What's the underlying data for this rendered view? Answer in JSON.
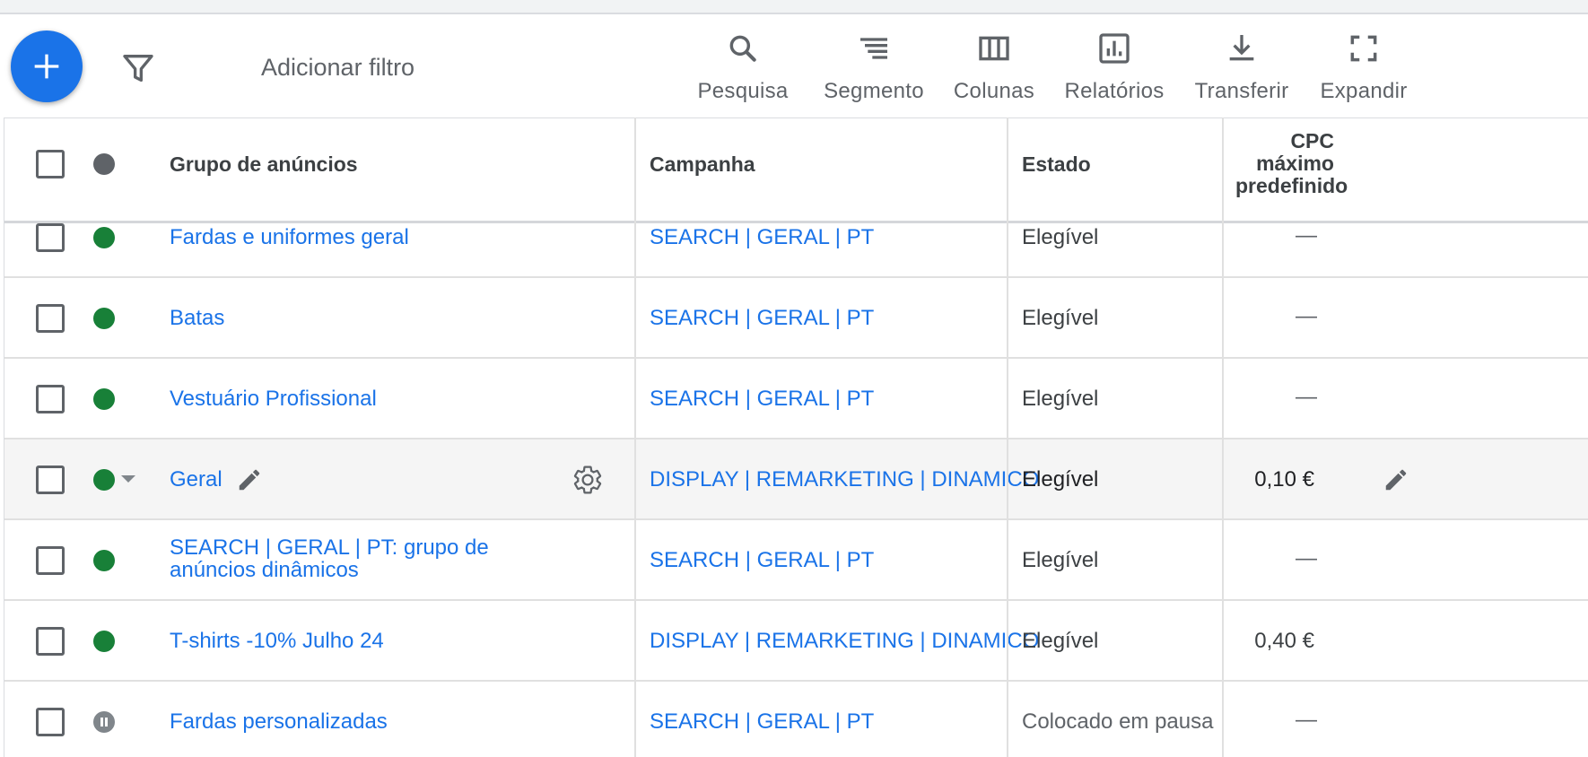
{
  "toolbar": {
    "add_filter_label": "Adicionar filtro",
    "tools": [
      {
        "label": "Pesquisa",
        "icon": "search-icon"
      },
      {
        "label": "Segmento",
        "icon": "segment-icon"
      },
      {
        "label": "Colunas",
        "icon": "columns-icon"
      },
      {
        "label": "Relatórios",
        "icon": "reports-icon"
      },
      {
        "label": "Transferir",
        "icon": "download-icon"
      },
      {
        "label": "Expandir",
        "icon": "fullscreen-icon"
      }
    ]
  },
  "table": {
    "headers": {
      "ad_group": "Grupo de anúncios",
      "campaign": "Campanha",
      "status": "Estado",
      "max_cpc_line1": "CPC",
      "max_cpc_line2": "máximo",
      "max_cpc_line3": "predefinido"
    },
    "rows": [
      {
        "name": "Fardas e uniformes geral",
        "campaign": "SEARCH | GERAL | PT",
        "status": "Elegível",
        "cpc": "—",
        "state": "enabled"
      },
      {
        "name": "Batas",
        "campaign": "SEARCH | GERAL | PT",
        "status": "Elegível",
        "cpc": "—",
        "state": "enabled"
      },
      {
        "name": "Vestuário Profissional",
        "campaign": "SEARCH | GERAL | PT",
        "status": "Elegível",
        "cpc": "—",
        "state": "enabled"
      },
      {
        "name": "Geral",
        "campaign": "DISPLAY | REMARKETING | DINAMICO",
        "status": "Elegível",
        "cpc": "0,10 €",
        "state": "enabled"
      },
      {
        "name_line1": "SEARCH | GERAL | PT: grupo de",
        "name_line2": "anúncios dinâmicos",
        "campaign": "SEARCH | GERAL | PT",
        "status": "Elegível",
        "cpc": "—",
        "state": "enabled"
      },
      {
        "name": "T-shirts -10% Julho 24",
        "campaign": "DISPLAY | REMARKETING | DINAMICO",
        "status": "Elegível",
        "cpc": "0,40 €",
        "state": "enabled"
      },
      {
        "name": "Fardas personalizadas",
        "campaign": "SEARCH | GERAL | PT",
        "status": "Colocado em pausa",
        "cpc": "—",
        "state": "paused"
      }
    ]
  },
  "colors": {
    "accent": "#1a73e8",
    "enabled": "#188038",
    "paused": "#80868b"
  }
}
